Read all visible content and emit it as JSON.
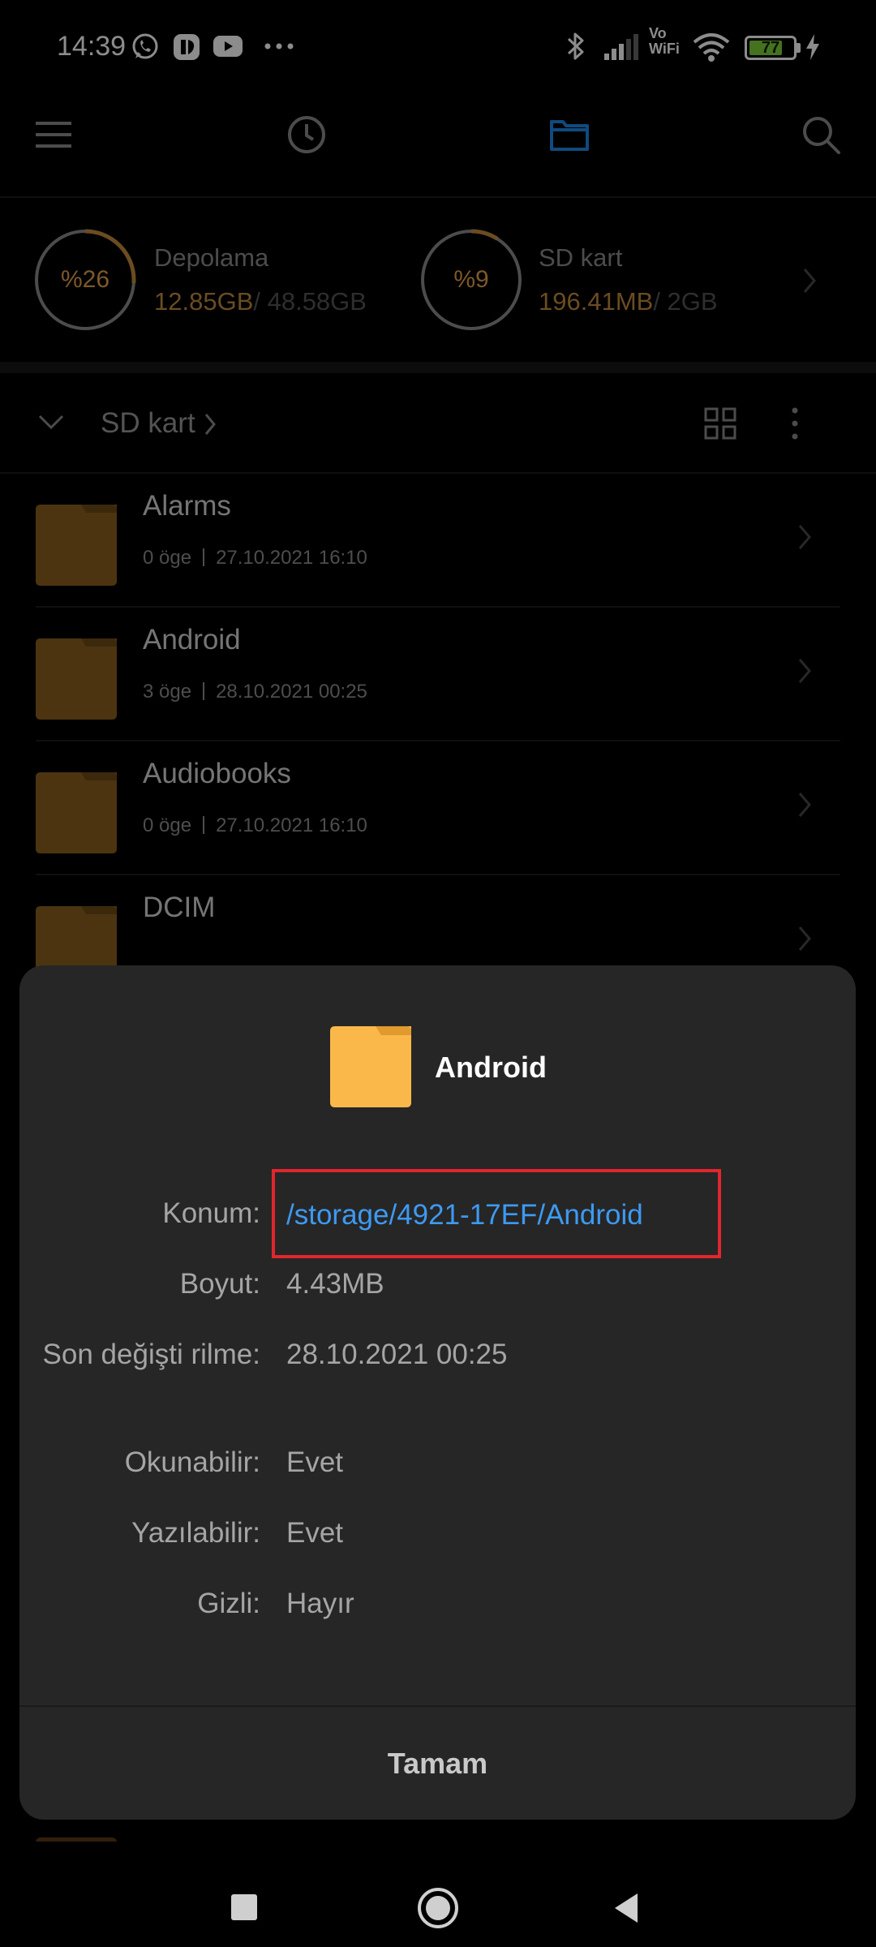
{
  "status_bar": {
    "time": "14:39",
    "vowifi_line1": "Vo",
    "vowifi_line2": "WiFi",
    "battery_level": "77",
    "battery_fraction": 0.77,
    "battery_color": "#7fcf3a",
    "icons": [
      "whatsapp-icon",
      "messenger-icon",
      "youtube-icon",
      "more-dots-icon",
      "bluetooth-icon",
      "signal-icon",
      "wifi-icon",
      "battery-icon",
      "charging-icon"
    ]
  },
  "toolbar": {
    "icons": [
      "menu-icon",
      "recent-icon",
      "folder-icon",
      "search-icon"
    ],
    "active_color": "#1e88e5"
  },
  "storage": [
    {
      "percent_label": "%26",
      "percent": 26,
      "name": "Depolama",
      "used": "12.85GB",
      "total": "/ 48.58GB"
    },
    {
      "percent_label": "%9",
      "percent": 9,
      "name": "SD kart",
      "used": "196.41MB",
      "total": "/ 2GB"
    }
  ],
  "path_bar": {
    "current": "SD kart"
  },
  "files": [
    {
      "name": "Alarms",
      "items": "0 öge",
      "date": "27.10.2021 16:10"
    },
    {
      "name": "Android",
      "items": "3 öge",
      "date": "28.10.2021 00:25"
    },
    {
      "name": "Audiobooks",
      "items": "0 öge",
      "date": "27.10.2021 16:10"
    },
    {
      "name": "DCIM",
      "items": "",
      "date": ""
    }
  ],
  "dialog": {
    "title": "Android",
    "properties": [
      {
        "label": "Konum:",
        "value": "/storage/4921-17EF/Android"
      },
      {
        "label": "Boyut:",
        "value": "4.43MB"
      },
      {
        "label": "Son değişti rilme:",
        "value": "28.10.2021 00:25"
      },
      {
        "label": "Okunabilir:",
        "value": "Evet"
      },
      {
        "label": "Yazılabilir:",
        "value": "Evet"
      },
      {
        "label": "Gizli:",
        "value": "Hayır"
      }
    ],
    "ok_label": "Tamam"
  },
  "colors": {
    "accent": "#1e88e5",
    "link": "#3d9af2",
    "folder": "#8a5f1f",
    "folder_dialog": "#fbb84a",
    "highlight": "#e0262e",
    "storage_used": "#c48a3e"
  }
}
